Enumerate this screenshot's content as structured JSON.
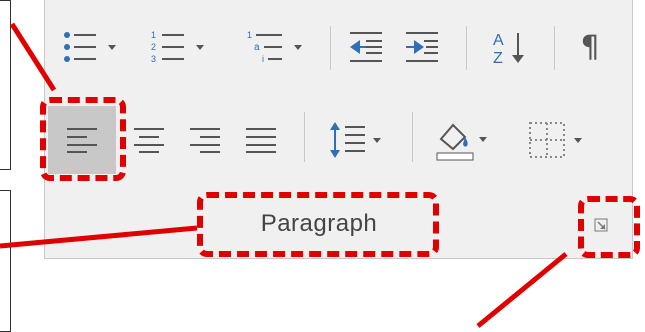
{
  "ribbon": {
    "group_label": "Paragraph",
    "row1": [
      "bullets",
      "numbering",
      "multilevel-list",
      "decrease-indent",
      "increase-indent",
      "sort",
      "show-formatting-marks"
    ],
    "row2": [
      "align-left",
      "center",
      "align-right",
      "justify",
      "line-spacing",
      "shading",
      "borders"
    ],
    "selected": "align-left"
  },
  "colors": {
    "highlight": "#e00000",
    "panel": "#f0f0f0",
    "accent_blue": "#2e6fb7",
    "selected_bg": "#c8c8c8"
  },
  "icons": [
    "bullets-icon",
    "numbering-icon",
    "multilevel-list-icon",
    "decrease-indent-icon",
    "increase-indent-icon",
    "sort-az-icon",
    "pilcrow-icon",
    "align-left-icon",
    "align-center-icon",
    "align-right-icon",
    "justify-icon",
    "line-spacing-icon",
    "paint-bucket-icon",
    "borders-icon",
    "dialog-launcher-icon"
  ]
}
